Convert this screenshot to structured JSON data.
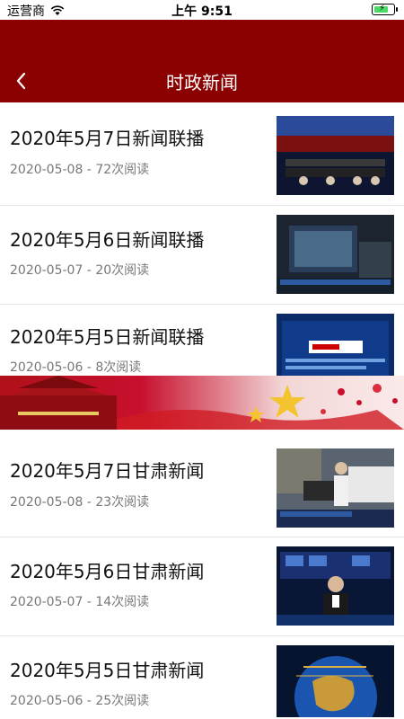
{
  "status_bar": {
    "carrier": "运营商",
    "time": "上午 9:51",
    "battery_level": 0.75
  },
  "header": {
    "title": "时政新闻",
    "back_icon": "chevron-left-icon"
  },
  "news_items": [
    {
      "title": "2020年5月7日新闻联播",
      "meta": "2020-05-08 - 72次阅读"
    },
    {
      "title": "2020年5月6日新闻联播",
      "meta": "2020-05-07 - 20次阅读"
    },
    {
      "title": "2020年5月5日新闻联播",
      "meta": "2020-05-06 - 8次阅读"
    },
    {
      "title": "2020年5月7日甘肃新闻",
      "meta": "2020-05-08 - 23次阅读"
    },
    {
      "title": "2020年5月6日甘肃新闻",
      "meta": "2020-05-07 - 14次阅读"
    },
    {
      "title": "2020年5月5日甘肃新闻",
      "meta": "2020-05-06 - 25次阅读"
    }
  ],
  "colors": {
    "nav_background": "#8b0000",
    "banner_red": "#c8102e",
    "divider": "#e3e3e3"
  }
}
